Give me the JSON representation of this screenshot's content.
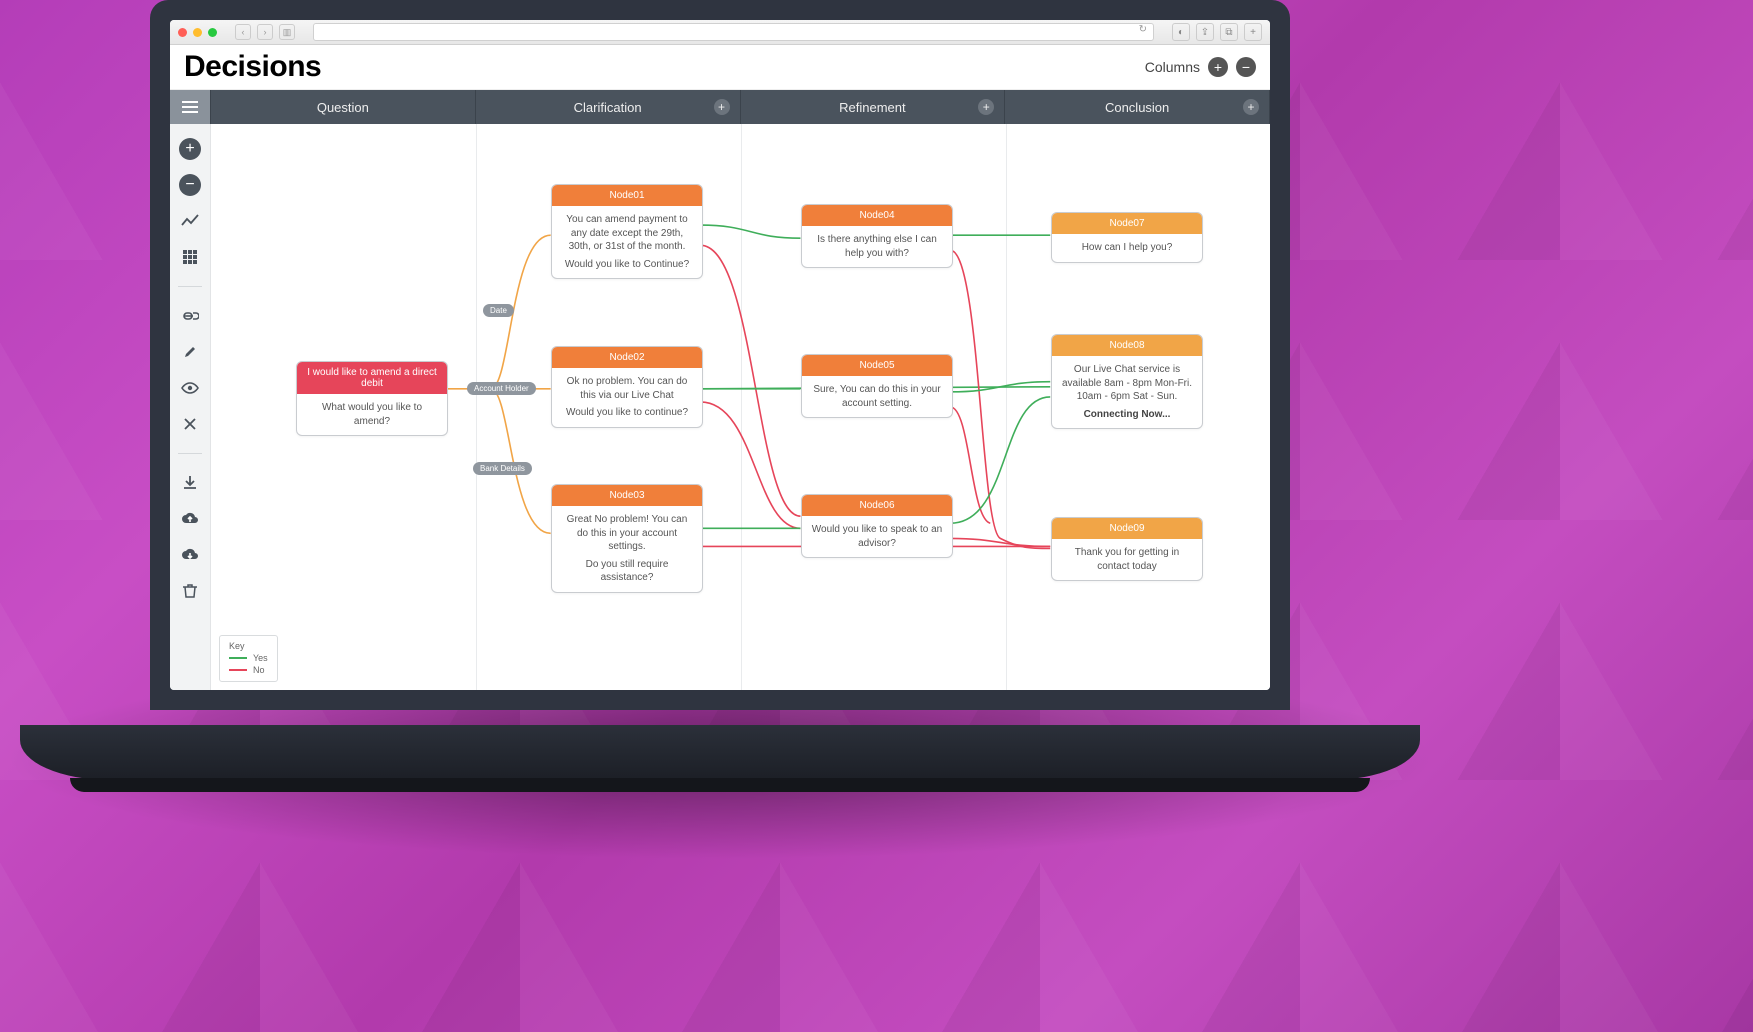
{
  "app": {
    "title": "Decisions"
  },
  "columns_control": {
    "label": "Columns"
  },
  "columns": [
    "Question",
    "Clarification",
    "Refinement",
    "Conclusion"
  ],
  "edge_labels": {
    "l1": "Date",
    "l2": "Account Holder",
    "l3": "Bank Details"
  },
  "legend": {
    "title": "Key",
    "yes": "Yes",
    "no": "No"
  },
  "nodes": {
    "q1": {
      "header": "I would like to amend a direct debit",
      "body": "What would you like to amend?"
    },
    "n01": {
      "header": "Node01",
      "body1": "You can amend payment to any date except the 29th, 30th, or 31st of the month.",
      "body2": "Would you like to Continue?"
    },
    "n02": {
      "header": "Node02",
      "body1": "Ok no problem. You can do this via our Live Chat",
      "body2": "Would you like to continue?"
    },
    "n03": {
      "header": "Node03",
      "body1": "Great No problem! You can do this in your account settings.",
      "body2": "Do you still require assistance?"
    },
    "n04": {
      "header": "Node04",
      "body": "Is there anything else I can help you with?"
    },
    "n05": {
      "header": "Node05",
      "body": "Sure, You can do this in your account setting."
    },
    "n06": {
      "header": "Node06",
      "body": "Would you like to speak to an advisor?"
    },
    "n07": {
      "header": "Node07",
      "body": "How can I help you?"
    },
    "n08": {
      "header": "Node08",
      "body1": "Our Live Chat service is available 8am - 8pm Mon-Fri. 10am - 6pm Sat - Sun.",
      "body2": "Connecting Now..."
    },
    "n09": {
      "header": "Node09",
      "body": "Thank you for getting in contact today"
    }
  }
}
